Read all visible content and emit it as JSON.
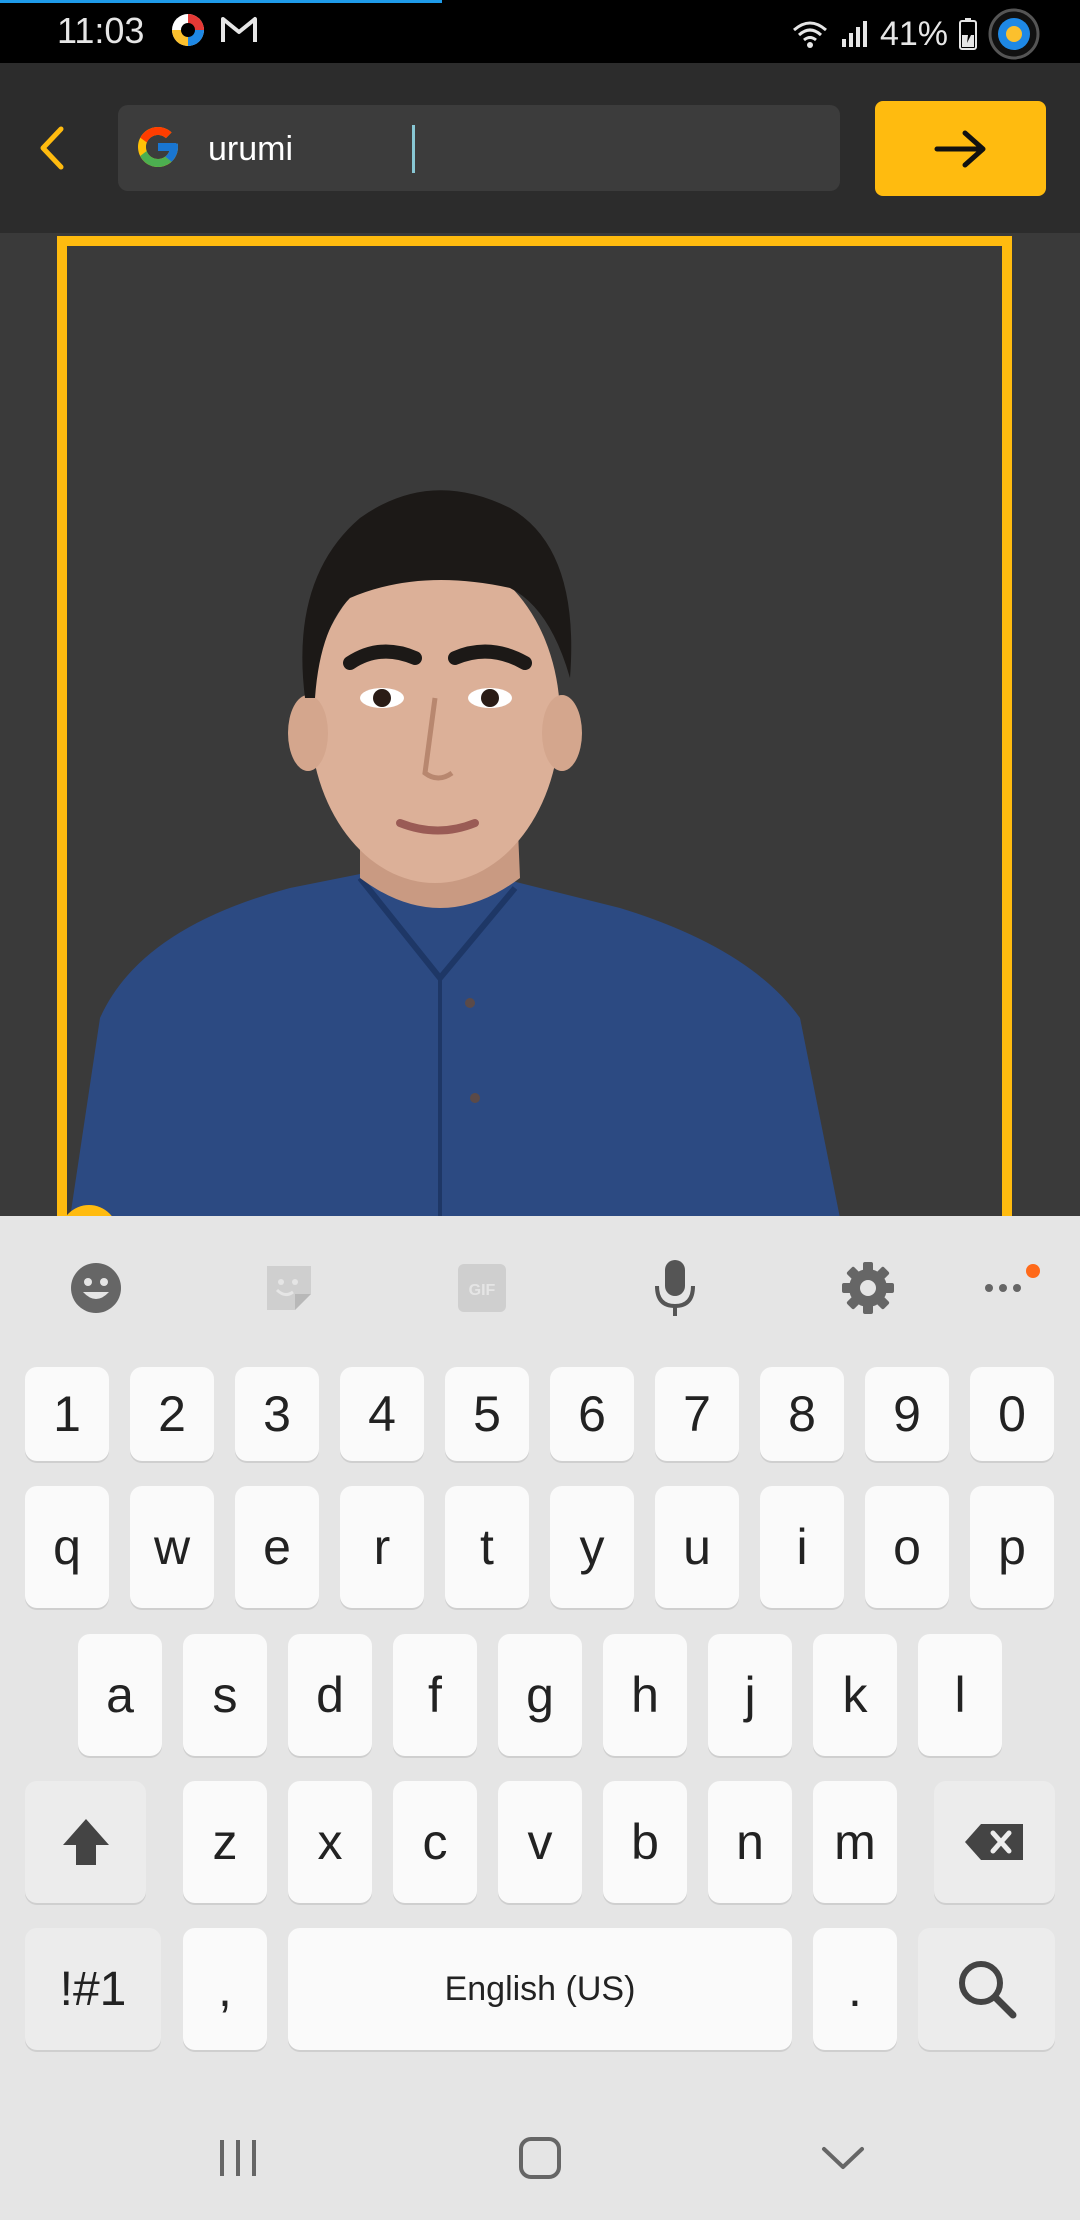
{
  "status_bar": {
    "time": "11:03",
    "battery_percent": "41%"
  },
  "search": {
    "query": "urumi",
    "engine_icon": "google-g-icon"
  },
  "actions": {
    "back_icon": "chevron-left-icon",
    "go_icon": "arrow-right-icon"
  },
  "colors": {
    "accent": "#ffbb0f",
    "keyboard_bg": "#e5e5e5",
    "topbar_bg": "#2c2c2c",
    "canvas_bg": "#3a3a3a"
  },
  "keyboard": {
    "toolbar": [
      "emoji-icon",
      "sticker-icon",
      "gif-icon",
      "microphone-icon",
      "settings-icon",
      "more-icon"
    ],
    "gif_label": "GIF",
    "number_row": [
      "1",
      "2",
      "3",
      "4",
      "5",
      "6",
      "7",
      "8",
      "9",
      "0"
    ],
    "row1": [
      "q",
      "w",
      "e",
      "r",
      "t",
      "y",
      "u",
      "i",
      "o",
      "p"
    ],
    "row2": [
      "a",
      "s",
      "d",
      "f",
      "g",
      "h",
      "j",
      "k",
      "l"
    ],
    "row3": [
      "z",
      "x",
      "c",
      "v",
      "b",
      "n",
      "m"
    ],
    "symbols_label": "!#1",
    "comma": ",",
    "space_label": "English (US)",
    "period": "."
  },
  "navbar": [
    "recent-apps-icon",
    "home-icon",
    "hide-keyboard-icon"
  ]
}
